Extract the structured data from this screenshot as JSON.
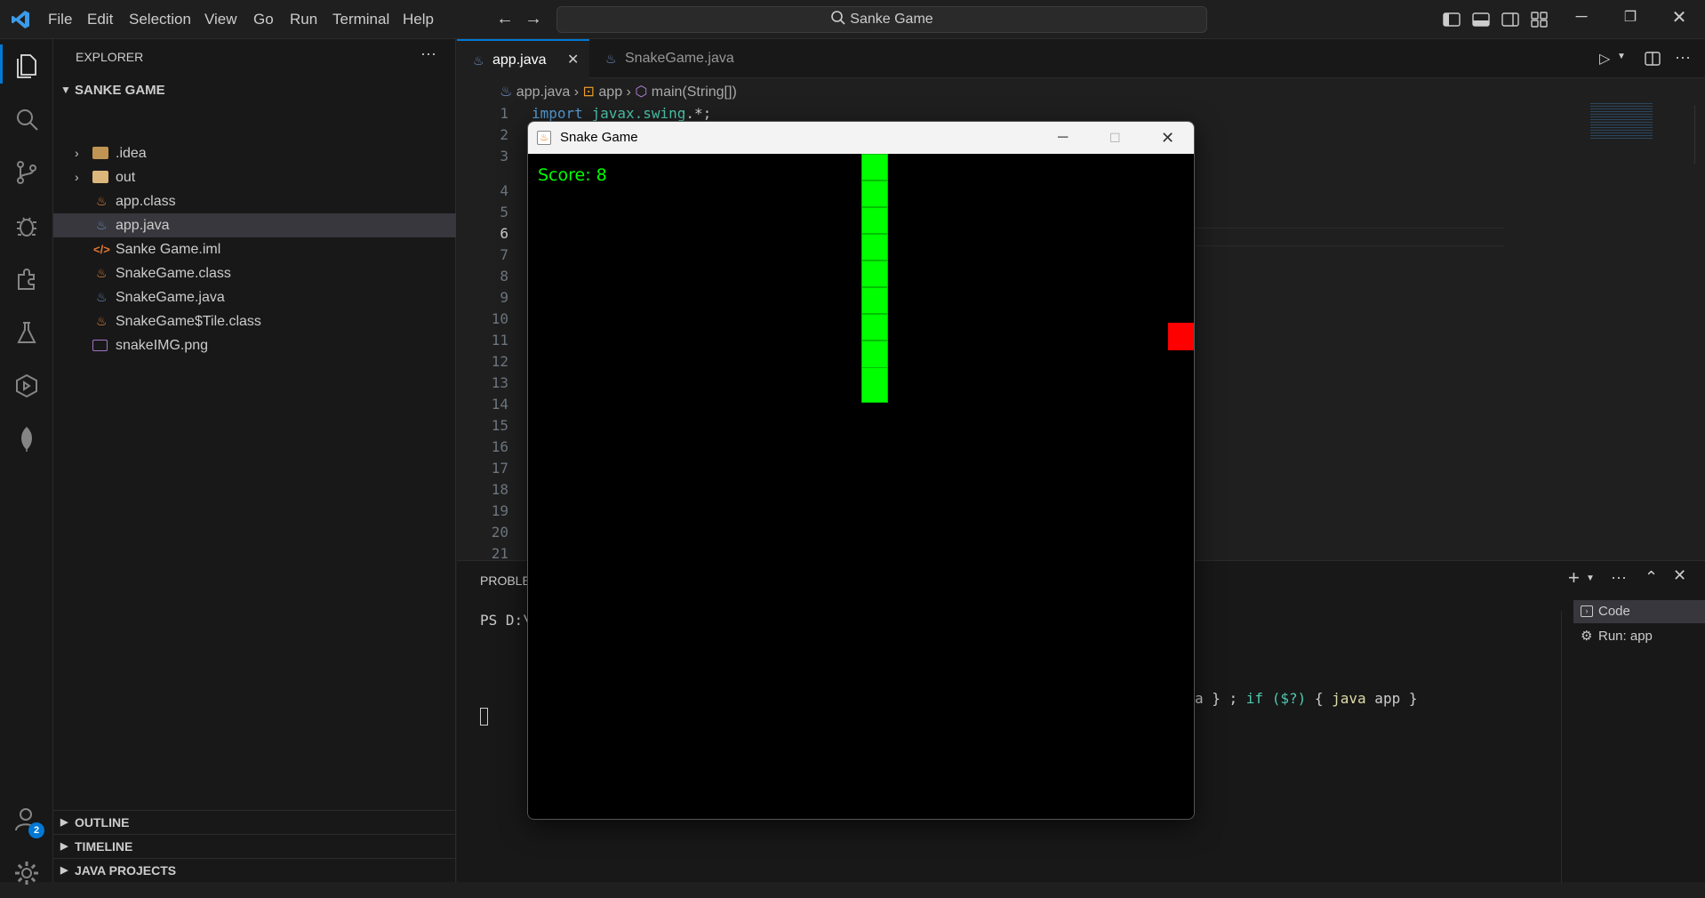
{
  "menu": [
    "File",
    "Edit",
    "Selection",
    "View",
    "Go",
    "Run",
    "Terminal",
    "Help"
  ],
  "search": {
    "text": "Sanke Game"
  },
  "explorer": {
    "title": "EXPLORER",
    "project": "SANKE GAME",
    "items": [
      {
        "label": ".idea",
        "kind": "folder"
      },
      {
        "label": "out",
        "kind": "folder"
      },
      {
        "label": "app.class",
        "kind": "java"
      },
      {
        "label": "app.java",
        "kind": "javafile"
      },
      {
        "label": "Sanke Game.iml",
        "kind": "xml"
      },
      {
        "label": "SnakeGame.class",
        "kind": "java"
      },
      {
        "label": "SnakeGame.java",
        "kind": "javafile"
      },
      {
        "label": "SnakeGame$Tile.class",
        "kind": "java"
      },
      {
        "label": "snakeIMG.png",
        "kind": "image"
      }
    ],
    "sections": [
      "OUTLINE",
      "TIMELINE",
      "JAVA PROJECTS"
    ]
  },
  "account_badge": "2",
  "tabs": [
    {
      "label": "app.java",
      "active": true
    },
    {
      "label": "SnakeGame.java",
      "active": false
    }
  ],
  "breadcrumb": {
    "file": "app.java",
    "cls": "app",
    "method": "main(String[])"
  },
  "code": {
    "line1_kw": "import",
    "line1_pkg": "javax.swing",
    "line1_rest": ".*;"
  },
  "line_numbers": [
    "1",
    "2",
    "3",
    "4",
    "5",
    "6",
    "7",
    "8",
    "9",
    "10",
    "11",
    "12",
    "13",
    "14",
    "15",
    "16",
    "17",
    "18",
    "19",
    "20",
    "21"
  ],
  "panel": {
    "tab": "PROBLEMS",
    "prompt": "PS D:\\",
    "cmd_tail_1": "a } ; ",
    "cmd_if": "if",
    "cmd_var": "($?)",
    "cmd_mid": " { ",
    "cmd_java": "java",
    "cmd_end": " app }",
    "terminals": [
      {
        "label": "Code"
      },
      {
        "label": "Run: app"
      }
    ]
  },
  "game": {
    "window_title": "Snake Game",
    "score_text": "Score: 8",
    "colors": {
      "snake": "#00ff00",
      "food": "#ff0000",
      "bg": "#000000"
    }
  }
}
